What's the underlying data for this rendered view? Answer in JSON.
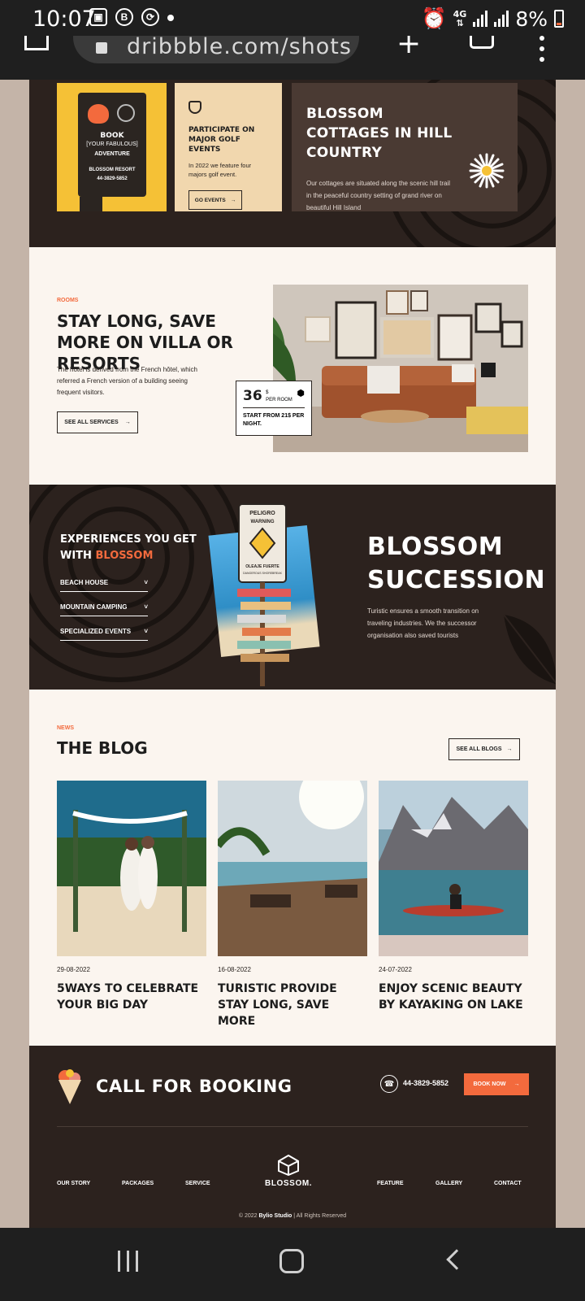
{
  "status_bar": {
    "time": "10:07",
    "net_top": "4G",
    "net_bottom": "⇅",
    "battery": "8%"
  },
  "browser": {
    "url": "dribbble.com/shots"
  },
  "top": {
    "sign": {
      "book": "BOOK",
      "subline": "[YOUR FABULOUS]",
      "adventure": "ADVENTURE",
      "resort": "BLOSSOM RESORT",
      "phone": "44-3829-5852"
    },
    "golf": {
      "title": "PARTICIPATE ON MAJOR GOLF EVENTS",
      "text": "In 2022 we feature four majors golf event.",
      "button": "GO EVENTS"
    },
    "cottage": {
      "title": "BLOSSOM COTTAGES IN HILL COUNTRY",
      "text": "Our cottages are situated along the scenic hill trail in the peaceful country setting of grand river on beautiful Hill Island"
    }
  },
  "rooms": {
    "kicker": "ROOMS",
    "title": "STAY LONG, SAVE MORE ON VILLA OR RESORTS",
    "text": "The hotel is derived from the French hôtel, which referred a French version of a building seeing frequent visitors.",
    "button": "SEE ALL SERVICES",
    "price": {
      "amount": "36",
      "currency": "$",
      "unit": "PER ROOM",
      "note": "START FROM 21$ PER NIGHT."
    }
  },
  "experiences": {
    "title_part1": "EXPERIENCES YOU GET",
    "title_part2": "WITH",
    "title_accent": "BLOSSOM",
    "items": [
      "BEACH HOUSE",
      "MOUNTAIN CAMPING",
      "SPECIALIZED EVENTS"
    ],
    "succession_line1": "BLOSSOM",
    "succession_line2": "SUCCESSION",
    "succession_text": "Turistic ensures a smooth transition on traveling industries. We the successor organisation also saved tourists",
    "sign_top": "PELIGRO",
    "sign_warning": "WARNING",
    "sign_oleaje": "OLEAJE FUERTE",
    "sign_danger": "DANGEROUS SHOREBREAK"
  },
  "blog": {
    "kicker": "NEWS",
    "title": "THE BLOG",
    "button": "SEE ALL BLOGS",
    "posts": [
      {
        "date": "29-08-2022",
        "title": "5WAYS TO CELEBRATE YOUR BIG DAY"
      },
      {
        "date": "16-08-2022",
        "title": "TURISTIC PROVIDE STAY LONG, SAVE MORE"
      },
      {
        "date": "24-07-2022",
        "title": "ENJOY SCENIC BEAUTY BY KAYAKING ON LAKE"
      }
    ]
  },
  "footer": {
    "call_title": "CALL FOR BOOKING",
    "phone": "44-3829-5852",
    "book_button": "BOOK NOW",
    "logo_text": "BLOSSOM.",
    "links": [
      "OUR STORY",
      "PACKAGES",
      "SERVICE",
      "FEATURE",
      "GALLERY",
      "CONTACT"
    ],
    "copyright_prefix": "© 2022",
    "copyright_brand": "Bylio Studio",
    "copyright_suffix": "| All Rights Reserved"
  },
  "colors": {
    "accent": "#f36a3d",
    "dark": "#2c221e",
    "cream": "#fbf5ef",
    "yellow": "#f5c136",
    "sand": "#f1d7ae"
  },
  "icons": {
    "arrow": "→",
    "chevron": "˅",
    "phone": "☎"
  }
}
